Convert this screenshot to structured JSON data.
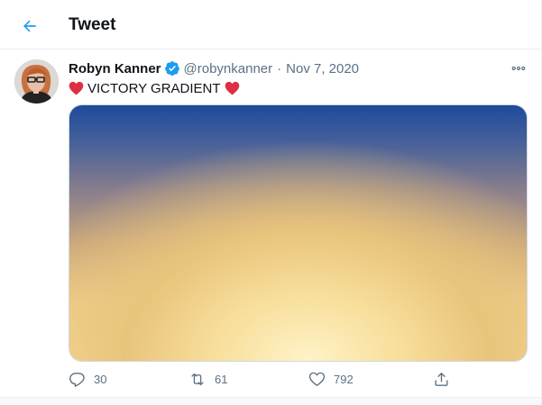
{
  "header": {
    "title": "Tweet"
  },
  "tweet": {
    "author_name": "Robyn Kanner",
    "author_handle": "@robynkanner",
    "separator": "·",
    "date": "Nov 7, 2020",
    "text": "VICTORY GRADIENT",
    "stats": {
      "replies": "30",
      "retweets": "61",
      "likes": "792"
    }
  },
  "icons": {
    "back": "arrow-left-icon",
    "verified": "verified-badge-icon",
    "more": "more-horizontal-icon",
    "emoji": "red-heart-icon",
    "reply": "reply-icon",
    "retweet": "retweet-icon",
    "like": "like-icon",
    "share": "share-icon"
  },
  "colors": {
    "accent": "#1d9bf0",
    "heart_emoji": "#dd2e44",
    "gradient_top": "#1e4a9c",
    "gradient_bottom": "#f7dd9d"
  }
}
